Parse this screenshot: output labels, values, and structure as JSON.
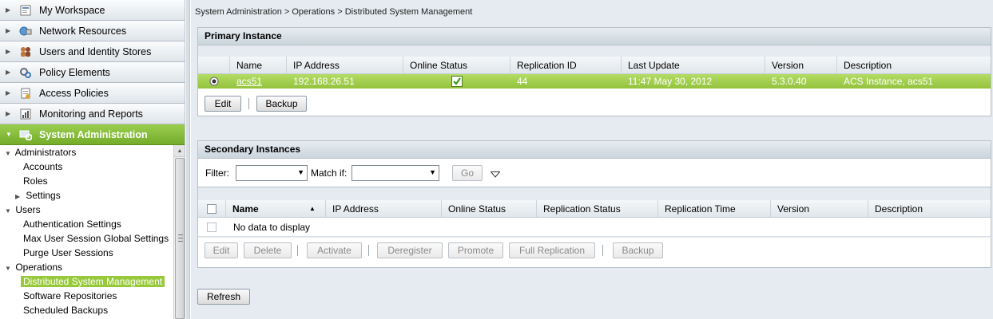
{
  "nav": {
    "drawers": [
      {
        "label": "My Workspace",
        "icon": "workspace-icon",
        "state": "collapsed"
      },
      {
        "label": "Network Resources",
        "icon": "network-icon",
        "state": "collapsed"
      },
      {
        "label": "Users and Identity Stores",
        "icon": "users-icon",
        "state": "collapsed"
      },
      {
        "label": "Policy Elements",
        "icon": "gears-icon",
        "state": "collapsed"
      },
      {
        "label": "Access Policies",
        "icon": "policy-icon",
        "state": "collapsed"
      },
      {
        "label": "Monitoring and Reports",
        "icon": "reports-icon",
        "state": "collapsed"
      },
      {
        "label": "System Administration",
        "icon": "system-admin-icon",
        "state": "expanded"
      }
    ],
    "tree": [
      {
        "label": "Administrators",
        "level": 0,
        "toggle": "expanded"
      },
      {
        "label": "Accounts",
        "level": 1
      },
      {
        "label": "Roles",
        "level": 1
      },
      {
        "label": "Settings",
        "level": 1,
        "toggle": "collapsed"
      },
      {
        "label": "Users",
        "level": 0,
        "toggle": "expanded"
      },
      {
        "label": "Authentication Settings",
        "level": 1
      },
      {
        "label": "Max User Session Global Settings",
        "level": 1
      },
      {
        "label": "Purge User Sessions",
        "level": 1
      },
      {
        "label": "Operations",
        "level": 0,
        "toggle": "expanded"
      },
      {
        "label": "Distributed System Management",
        "level": 1,
        "selected": true
      },
      {
        "label": "Software Repositories",
        "level": 1
      },
      {
        "label": "Scheduled Backups",
        "level": 1
      }
    ]
  },
  "breadcrumb": "System Administration > Operations > Distributed System Management",
  "primary": {
    "title": "Primary Instance",
    "columns": [
      "Name",
      "IP Address",
      "Online Status",
      "Replication ID",
      "Last Update",
      "Version",
      "Description"
    ],
    "row": {
      "name": "acs51",
      "ip": "192.168.26.51",
      "online": true,
      "replication_id": "44",
      "last_update": "11:47 May 30, 2012",
      "version": "5.3.0.40",
      "description": "ACS Instance, acs51"
    },
    "buttons": {
      "edit": "Edit",
      "backup": "Backup"
    }
  },
  "secondary": {
    "title": "Secondary Instances",
    "filter_label": "Filter:",
    "filter_value": "",
    "match_label": "Match if:",
    "match_value": "",
    "go_label": "Go",
    "columns": [
      "Name",
      "IP Address",
      "Online Status",
      "Replication Status",
      "Replication Time",
      "Version",
      "Description"
    ],
    "sort": {
      "column": "Name",
      "direction": "ascending"
    },
    "empty_text": "No data to display",
    "buttons": {
      "edit": "Edit",
      "delete": "Delete",
      "activate": "Activate",
      "deregister": "Deregister",
      "promote": "Promote",
      "full_replication": "Full Replication",
      "backup": "Backup"
    }
  },
  "refresh_label": "Refresh",
  "colors": {
    "accent_green": "#8cc63f",
    "row_selected": "#a4d14d",
    "panel_bg": "#e5ebf0"
  }
}
